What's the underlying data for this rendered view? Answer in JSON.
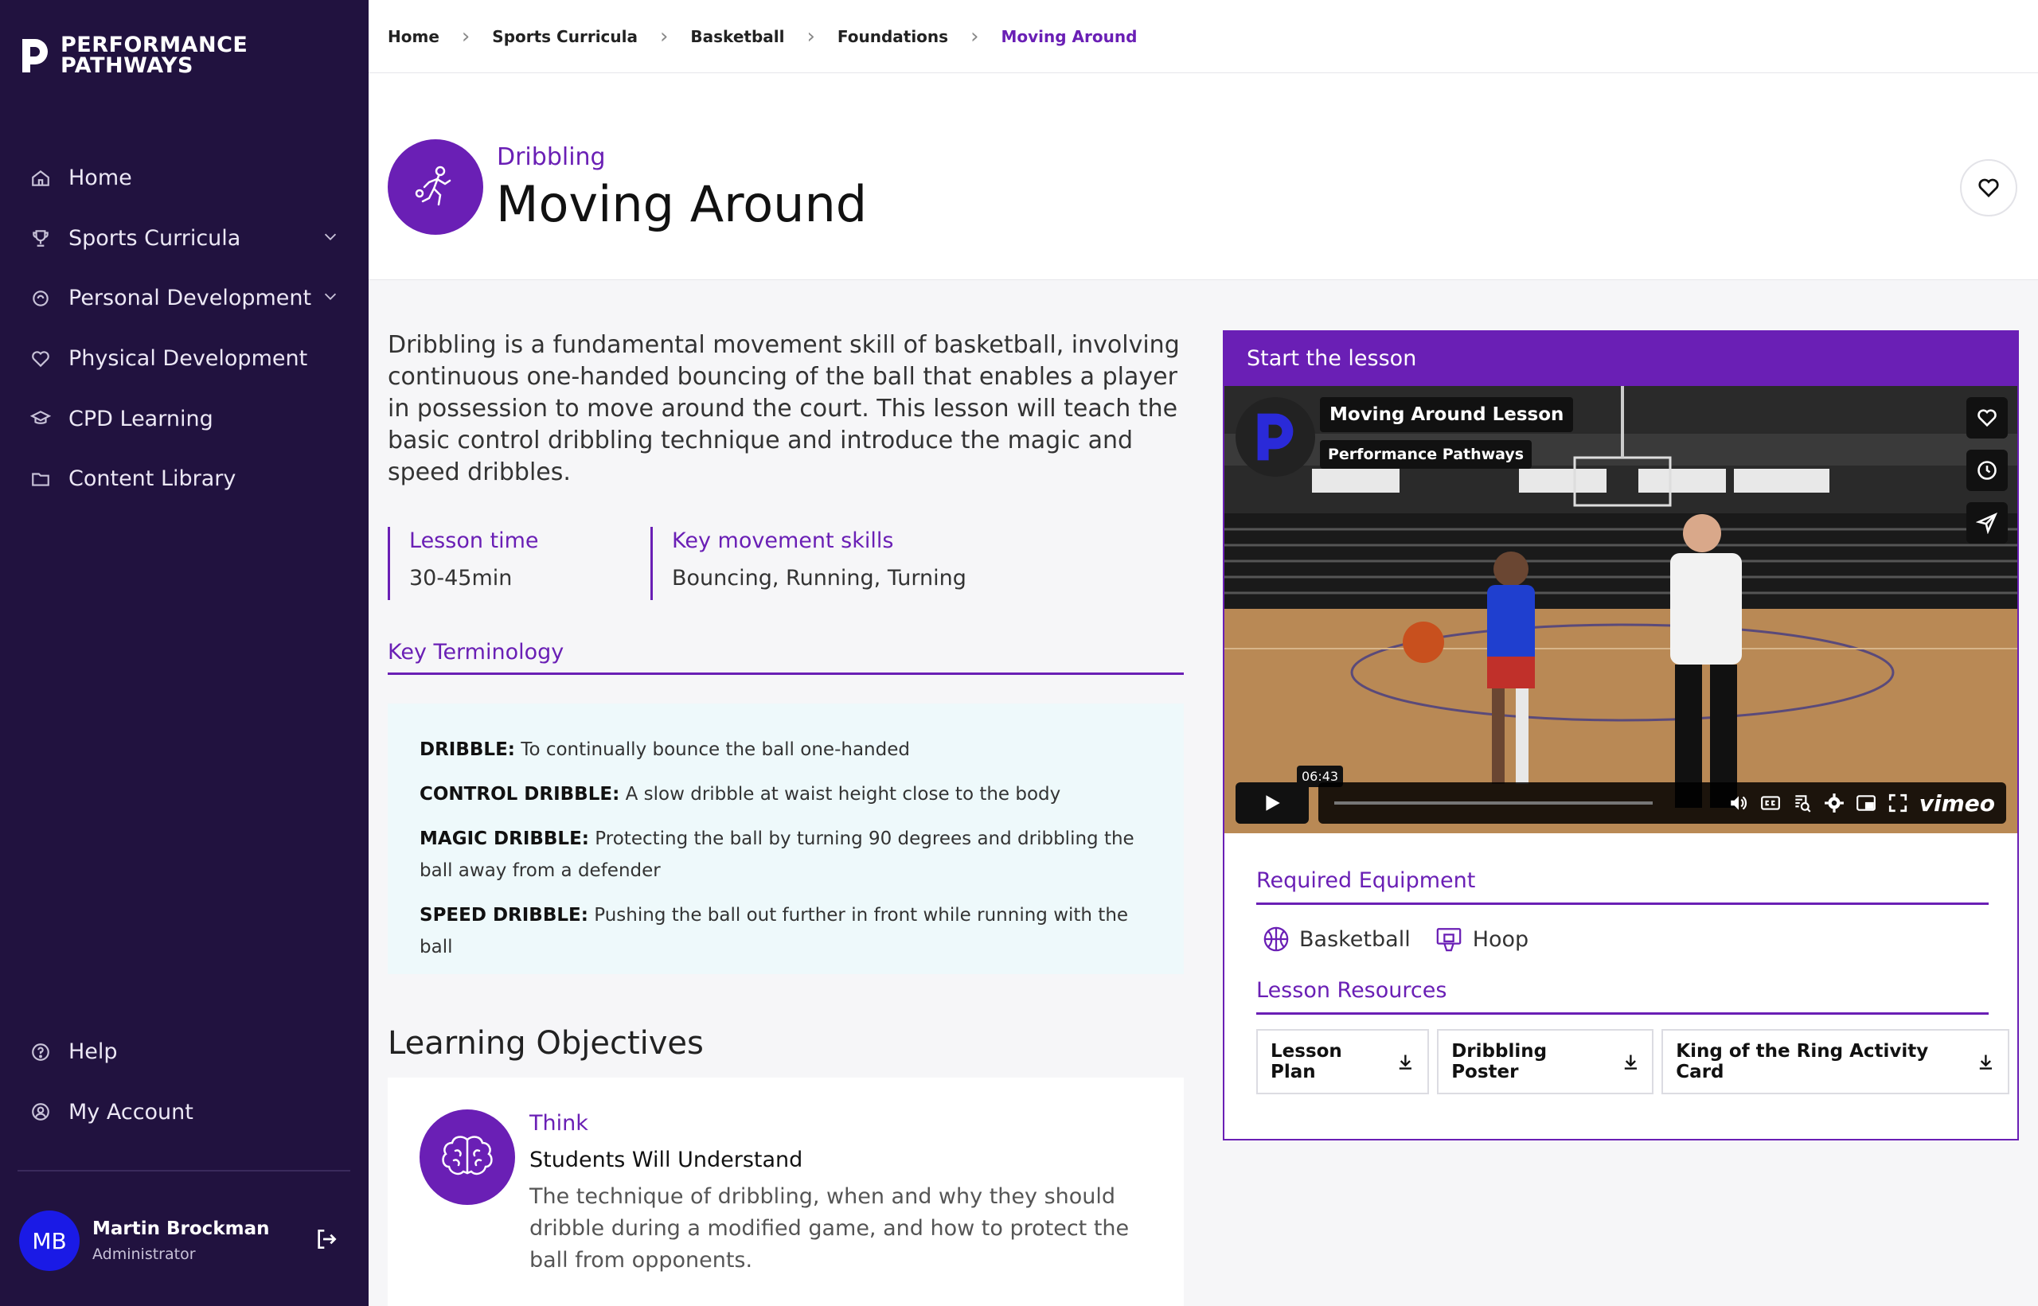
{
  "app": {
    "logo_line1": "PERFORMANCE",
    "logo_line2": "PATHWAYS"
  },
  "sidebar": {
    "items": [
      {
        "label": "Home",
        "icon": "home-icon"
      },
      {
        "label": "Sports Curricula",
        "icon": "trophy-icon",
        "expandable": true
      },
      {
        "label": "Personal Development",
        "icon": "personal-icon",
        "expandable": true
      },
      {
        "label": "Physical Development",
        "icon": "heart-icon"
      },
      {
        "label": "CPD Learning",
        "icon": "graduation-icon"
      },
      {
        "label": "Content Library",
        "icon": "folder-icon"
      }
    ],
    "bottom": [
      {
        "label": "Help",
        "icon": "help-icon"
      },
      {
        "label": "My Account",
        "icon": "account-icon"
      }
    ],
    "user": {
      "initials": "MB",
      "name": "Martin Brockman",
      "role": "Administrator"
    }
  },
  "breadcrumb": [
    "Home",
    "Sports Curricula",
    "Basketball",
    "Foundations",
    "Moving Around"
  ],
  "hero": {
    "subtitle": "Dribbling",
    "title": "Moving Around"
  },
  "description": "Dribbling is a fundamental movement skill of basketball, involving continuous one-handed bouncing of the ball that enables a player in possession to move around the court. This lesson will teach the basic control dribbling technique and introduce the magic and speed dribbles.",
  "meta": {
    "lesson_time_label": "Lesson time",
    "lesson_time": "30-45min",
    "skills_label": "Key movement skills",
    "skills": "Bouncing, Running, Turning"
  },
  "terminology": {
    "heading": "Key Terminology",
    "terms": [
      {
        "term": "DRIBBLE:",
        "def": " To continually bounce the ball one-handed"
      },
      {
        "term": "CONTROL DRIBBLE:",
        "def": " A slow dribble at waist height close to the body"
      },
      {
        "term": "MAGIC DRIBBLE:",
        "def": " Protecting the ball by turning 90 degrees and dribbling the ball away from a defender"
      },
      {
        "term": "SPEED DRIBBLE:",
        "def": " Pushing the ball out further in front while running with the ball"
      }
    ]
  },
  "objectives": {
    "title": "Learning Objectives",
    "tag": "Think",
    "heading": "Students Will Understand",
    "text": "The technique of dribbling, when and why they should dribble during a modified game, and how to protect the ball from opponents."
  },
  "lesson": {
    "header": "Start the lesson",
    "video_title": "Moving Around Lesson",
    "video_channel": "Performance Pathways",
    "time_tooltip": "06:43",
    "player_brand": "vimeo",
    "equipment_heading": "Required Equipment",
    "equipment": [
      "Basketball",
      "Hoop"
    ],
    "resources_heading": "Lesson Resources",
    "resources": [
      "Lesson Plan",
      "Dribbling Poster",
      "King of the Ring Activity Card"
    ]
  },
  "colors": {
    "sidebar": "#21123f",
    "accent": "#6a1fb5",
    "term_bg": "#eef9fb",
    "avatar": "#1a1ae6"
  }
}
